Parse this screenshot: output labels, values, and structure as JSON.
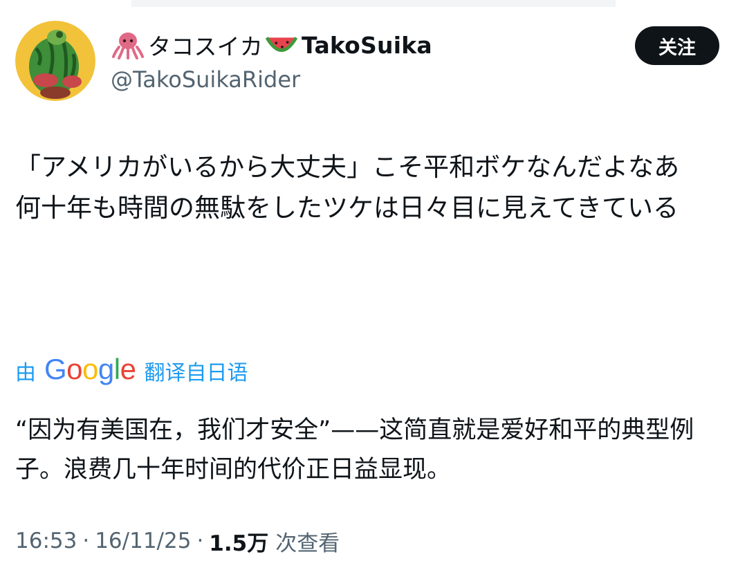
{
  "user": {
    "display_name": "タコスイカ",
    "display_name_en": "TakoSuika",
    "emoji_before": "octopus-emoji",
    "emoji_after": "watermelon-emoji",
    "handle": "@TakoSuikaRider"
  },
  "follow_button": {
    "label": "关注"
  },
  "tweet": {
    "lines": [
      "「アメリカがいるから大丈夫」こそ平和ボケなんだよなあ",
      "何十年も時間の無駄をしたツケは日々目に見えてきている"
    ]
  },
  "translation": {
    "prefix": "由",
    "brand": "Google",
    "suffix": "翻译自日语",
    "text": "“因为有美国在，我们才安全”——这简直就是爱好和平的典型例子。浪费几十年时间的代价正日益显现。"
  },
  "meta": {
    "time": "16:53",
    "date": "16/11/25",
    "views_count": "1.5万",
    "views_label": "次查看"
  },
  "colors": {
    "link_blue": "#1d9bf0",
    "secondary_gray": "#536471",
    "button_black": "#0f1419"
  }
}
